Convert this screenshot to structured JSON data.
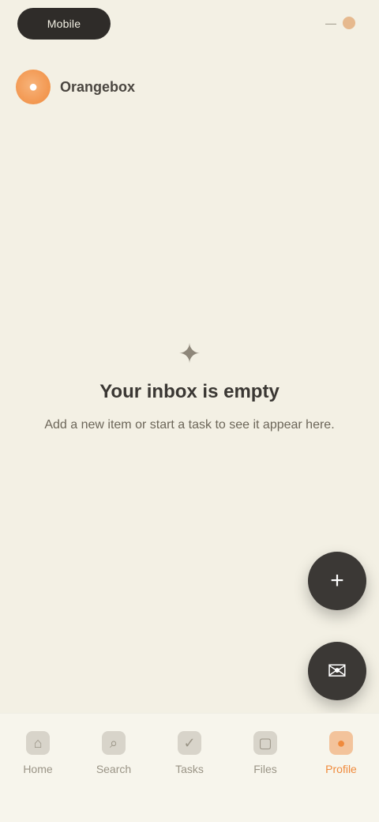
{
  "header": {
    "pill_text": "Mobile",
    "right_text": "—",
    "accent_color": "#f08a3c"
  },
  "brand": {
    "name": "Orangebox",
    "icon": "orange-brand-icon"
  },
  "empty_state": {
    "icon": "sparkle-icon",
    "title": "Your inbox is empty",
    "description": "Add a new item or start a task to see it appear here."
  },
  "fabs": [
    {
      "icon": "plus-icon"
    },
    {
      "icon": "chat-icon"
    }
  ],
  "bottom_nav": {
    "items": [
      {
        "label": "Home",
        "icon": "home-icon",
        "active": false
      },
      {
        "label": "Search",
        "icon": "search-icon",
        "active": false
      },
      {
        "label": "Tasks",
        "icon": "check-icon",
        "active": false
      },
      {
        "label": "Files",
        "icon": "folder-icon",
        "active": false
      },
      {
        "label": "Profile",
        "icon": "user-icon",
        "active": true
      }
    ]
  }
}
